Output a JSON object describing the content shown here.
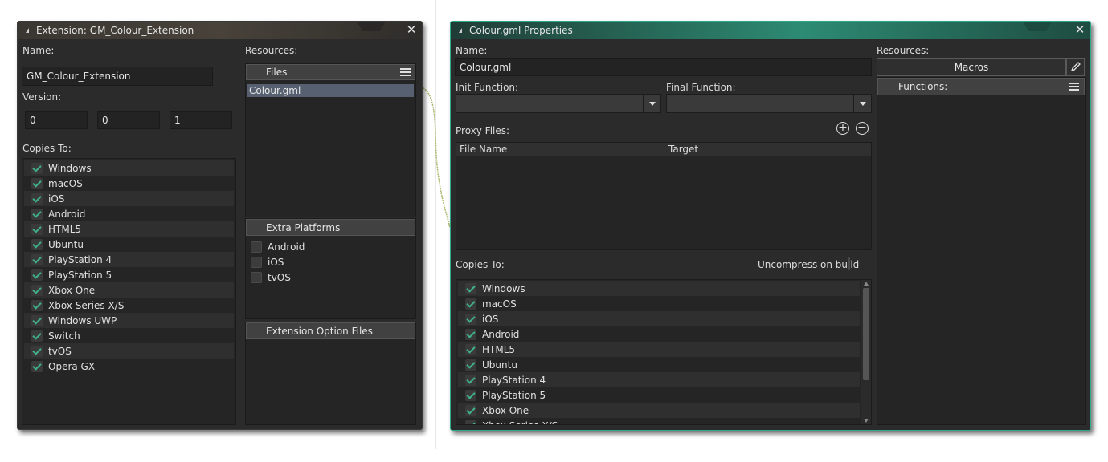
{
  "left_window": {
    "title": "Extension: GM_Colour_Extension",
    "name_label": "Name:",
    "name_value": "GM_Colour_Extension",
    "version_label": "Version:",
    "version": [
      "0",
      "0",
      "1"
    ],
    "copies_to_label": "Copies To:",
    "copies_to": [
      {
        "label": "Windows",
        "checked": true
      },
      {
        "label": "macOS",
        "checked": true
      },
      {
        "label": "iOS",
        "checked": true
      },
      {
        "label": "Android",
        "checked": true
      },
      {
        "label": "HTML5",
        "checked": true
      },
      {
        "label": "Ubuntu",
        "checked": true
      },
      {
        "label": "PlayStation 4",
        "checked": true
      },
      {
        "label": "PlayStation 5",
        "checked": true
      },
      {
        "label": "Xbox One",
        "checked": true
      },
      {
        "label": "Xbox Series X/S",
        "checked": true
      },
      {
        "label": "Windows UWP",
        "checked": true
      },
      {
        "label": "Switch",
        "checked": true
      },
      {
        "label": "tvOS",
        "checked": true
      },
      {
        "label": "Opera GX",
        "checked": true
      }
    ],
    "resources_label": "Resources:",
    "files_header": "Files",
    "files": [
      "Colour.gml"
    ],
    "extra_platforms_header": "Extra Platforms",
    "extra_platforms": [
      {
        "label": "Android",
        "checked": false
      },
      {
        "label": "iOS",
        "checked": false
      },
      {
        "label": "tvOS",
        "checked": false
      }
    ],
    "option_files_header": "Extension Option Files"
  },
  "right_window": {
    "title": "Colour.gml Properties",
    "name_label": "Name:",
    "name_value": "Colour.gml",
    "init_function_label": "Init Function:",
    "init_function_value": "",
    "final_function_label": "Final Function:",
    "final_function_value": "",
    "proxy_files_label": "Proxy Files:",
    "proxy_columns": [
      "File Name",
      "Target"
    ],
    "copies_to_label": "Copies To:",
    "uncompress_label": "Uncompress on build",
    "uncompress_checked": false,
    "copies_to": [
      {
        "label": "Windows",
        "checked": true
      },
      {
        "label": "macOS",
        "checked": true
      },
      {
        "label": "iOS",
        "checked": true
      },
      {
        "label": "Android",
        "checked": true
      },
      {
        "label": "HTML5",
        "checked": true
      },
      {
        "label": "Ubuntu",
        "checked": true
      },
      {
        "label": "PlayStation 4",
        "checked": true
      },
      {
        "label": "PlayStation 5",
        "checked": true
      },
      {
        "label": "Xbox One",
        "checked": true
      },
      {
        "label": "Xbox Series X/S",
        "checked": true
      }
    ],
    "resources_label": "Resources:",
    "macros_button": "Macros",
    "functions_header": "Functions:"
  },
  "icons": {
    "collapse": "collapse-triangle-icon",
    "close": "close-icon",
    "menu": "hamburger-menu-icon",
    "add": "plus-circle-icon",
    "remove": "minus-circle-icon",
    "edit": "pencil-icon",
    "check": "checkmark-icon",
    "dropdown": "chevron-down-icon"
  },
  "colors": {
    "accent": "#2fa88a",
    "check": "#3fb28a",
    "window_bg": "#2b2b2b"
  }
}
